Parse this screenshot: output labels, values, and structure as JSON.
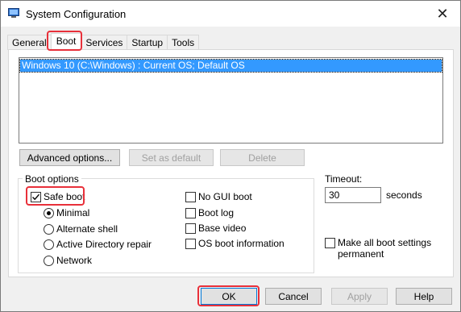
{
  "window": {
    "title": "System Configuration",
    "close_glyph": "✕"
  },
  "tabs": [
    {
      "label": "General"
    },
    {
      "label": "Boot"
    },
    {
      "label": "Services"
    },
    {
      "label": "Startup"
    },
    {
      "label": "Tools"
    }
  ],
  "os_list": {
    "items": [
      "Windows 10 (C:\\Windows) : Current OS; Default OS"
    ]
  },
  "buttons": {
    "advanced": "Advanced options...",
    "set_default": "Set as default",
    "delete": "Delete"
  },
  "boot_options": {
    "label": "Boot options",
    "safe_boot": "Safe boot",
    "minimal": "Minimal",
    "alternate_shell": "Alternate shell",
    "active_directory_repair": "Active Directory repair",
    "network": "Network",
    "no_gui_boot": "No GUI boot",
    "boot_log": "Boot log",
    "base_video": "Base video",
    "os_boot_information": "OS boot information"
  },
  "timeout": {
    "label": "Timeout:",
    "value": "30",
    "unit": "seconds"
  },
  "make_permanent": "Make all boot settings permanent",
  "footer": {
    "ok": "OK",
    "cancel": "Cancel",
    "apply": "Apply",
    "help": "Help"
  },
  "colors": {
    "highlight": "#e8303a",
    "selection": "#3399ff"
  }
}
